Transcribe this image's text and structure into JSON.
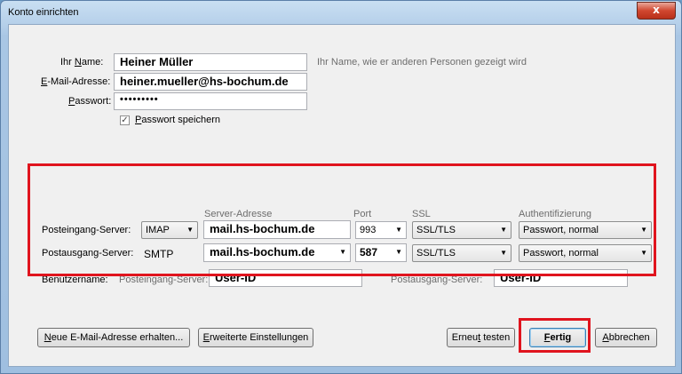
{
  "window": {
    "title": "Konto einrichten",
    "close_glyph": "x"
  },
  "account": {
    "name_label_pre": "Ihr ",
    "name_label_key": "N",
    "name_label_post": "ame:",
    "name_value": "Heiner Müller",
    "name_hint": "Ihr Name, wie er anderen Personen gezeigt wird",
    "email_label_key": "E",
    "email_label_post": "-Mail-Adresse:",
    "email_value": "heiner.mueller@hs-bochum.de",
    "password_label_key": "P",
    "password_label_post": "asswort:",
    "password_value": "•••••••••",
    "save_password_checked": true,
    "save_password_key": "P",
    "save_password_post": "asswort speichern"
  },
  "server": {
    "headers": {
      "address": "Server-Adresse",
      "port": "Port",
      "ssl": "SSL",
      "auth": "Authentifizierung"
    },
    "incoming": {
      "label": "Posteingang-Server:",
      "protocol": "IMAP",
      "address": "mail.hs-bochum.de",
      "port": "993",
      "ssl": "SSL/TLS",
      "auth": "Passwort, normal"
    },
    "outgoing": {
      "label": "Postausgang-Server:",
      "protocol": "SMTP",
      "address": "mail.hs-bochum.de",
      "port": "587",
      "ssl": "SSL/TLS",
      "auth": "Passwort, normal"
    },
    "username": {
      "label": "Benutzername:",
      "incoming_label": "Posteingang-Server:",
      "incoming_value": "User-ID",
      "outgoing_label": "Postausgang-Server:",
      "outgoing_value": "User-ID"
    }
  },
  "buttons": {
    "new_address_key": "N",
    "new_address_post": "eue E-Mail-Adresse erhalten...",
    "advanced_key": "E",
    "advanced_post": "rweiterte Einstellungen",
    "retest_pre": "Erneu",
    "retest_key": "t",
    "retest_post": " testen",
    "done_key": "F",
    "done_post": "ertig",
    "cancel_key": "A",
    "cancel_post": "bbrechen"
  },
  "colors": {
    "highlight": "#e0141e",
    "hint_text": "#6d6d6d"
  },
  "icons": {
    "dropdown": "▼",
    "check": "✓"
  }
}
